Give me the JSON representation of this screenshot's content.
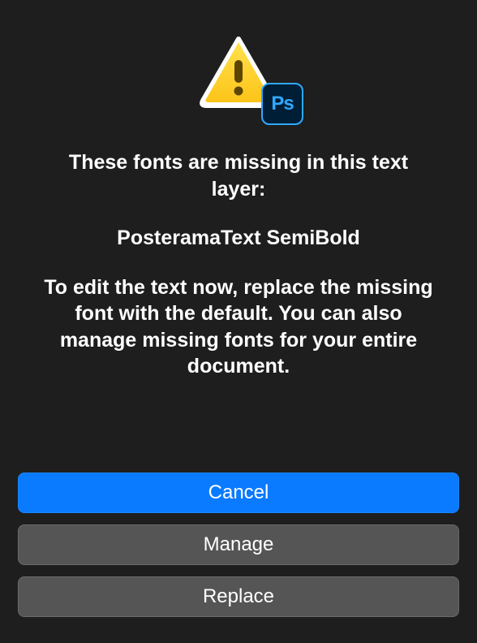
{
  "dialog": {
    "heading": "These fonts are missing in this text layer:",
    "missing_font": "PosteramaText SemiBold",
    "instruction": "To edit the text now, replace the missing font with the default. You can also manage missing fonts for your entire document.",
    "ps_badge_label": "Ps"
  },
  "buttons": {
    "cancel": "Cancel",
    "manage": "Manage",
    "replace": "Replace"
  }
}
